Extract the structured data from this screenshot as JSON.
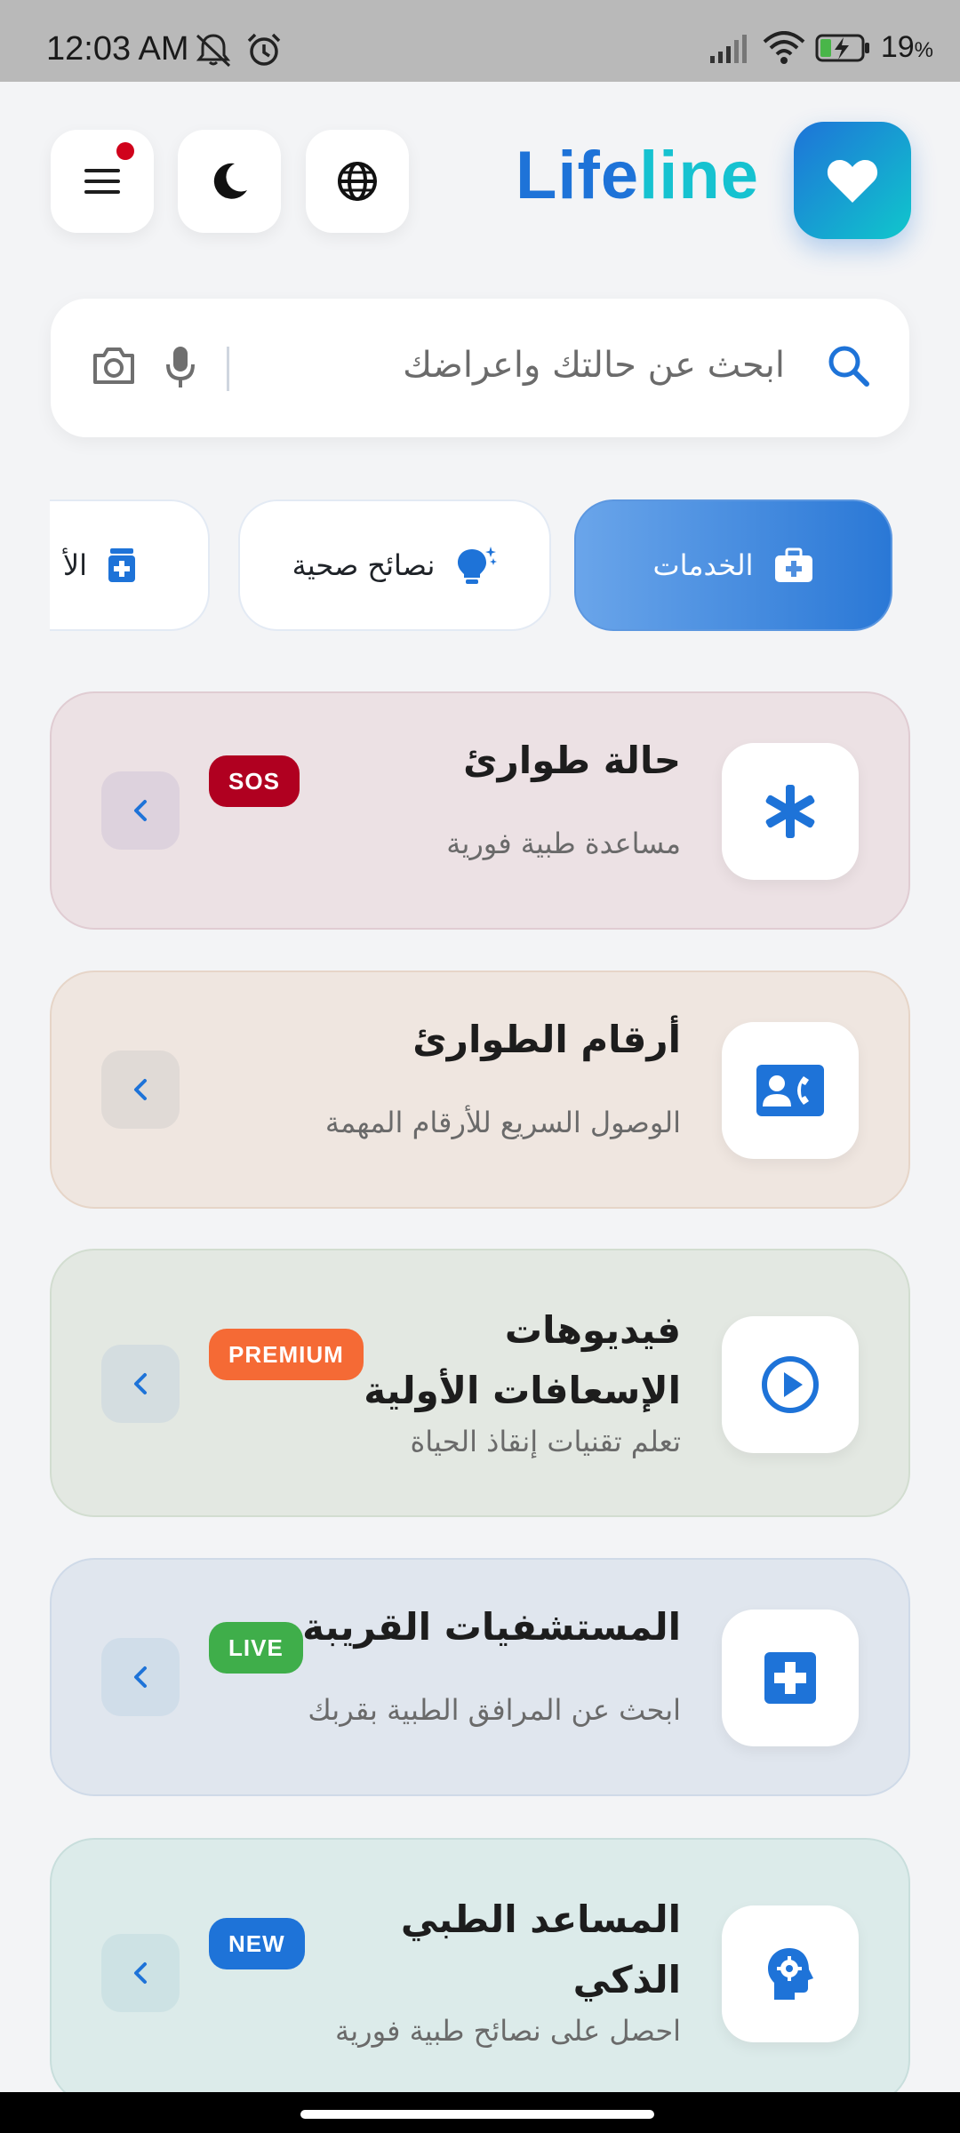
{
  "status_bar": {
    "time": "12:03 AM",
    "battery_percent": "19",
    "battery_unit": "%",
    "icons": [
      "mute-bell-icon",
      "alarm-icon",
      "signal-icon",
      "wifi-icon",
      "battery-charging-icon"
    ]
  },
  "header": {
    "brand_part1": "Life",
    "brand_part2": "line",
    "buttons": [
      "menu-icon",
      "moon-icon",
      "globe-icon",
      "heart-icon"
    ]
  },
  "search": {
    "placeholder": "ابحث عن حالتك واعراضك"
  },
  "tabs": [
    {
      "label": "الخدمات",
      "icon": "medkit-icon",
      "active": true
    },
    {
      "label": "نصائح صحية",
      "icon": "lightbulb-icon",
      "active": false
    },
    {
      "label": "الأ",
      "icon": "medicine-icon",
      "active": false
    }
  ],
  "cards": [
    {
      "title": "حالة طوارئ",
      "subtitle": "مساعدة طبية فورية",
      "badge": "SOS",
      "badge_color": "#b00020",
      "icon": "asterisk-icon"
    },
    {
      "title": "أرقام الطوارئ",
      "subtitle": "الوصول السريع للأرقام المهمة",
      "badge": "",
      "icon": "contact-phone-icon"
    },
    {
      "title_line1": "فيديوهات",
      "title_line2": "الإسعافات الأولية",
      "subtitle": "تعلم تقنيات إنقاذ الحياة",
      "badge": "PREMIUM",
      "badge_color": "#f56a35",
      "icon": "play-circle-icon"
    },
    {
      "title": "المستشفيات القريبة",
      "subtitle": "ابحث عن المرافق الطبية بقربك",
      "badge": "LIVE",
      "badge_color": "#3fae4a",
      "icon": "hospital-cross-icon"
    },
    {
      "title_line1": "المساعد الطبي",
      "title_line2": "الذكي",
      "subtitle": "احصل على نصائح طبية فورية",
      "badge": "NEW",
      "badge_color": "#1e73d8",
      "icon": "ai-head-gear-icon"
    }
  ],
  "colors": {
    "primary": "#1e73d8",
    "accent": "#16c2d0"
  }
}
